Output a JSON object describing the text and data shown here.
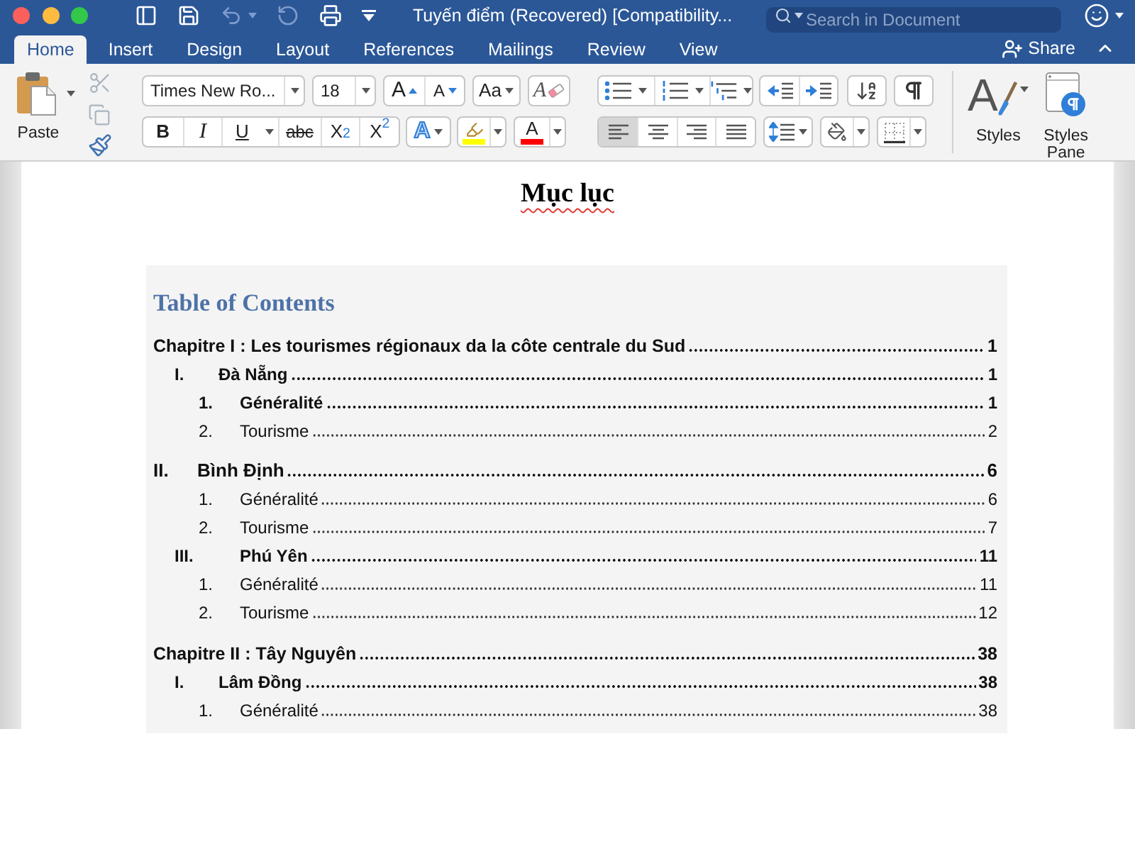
{
  "window": {
    "title": "Tuyến điểm (Recovered) [Compatibility...",
    "quick_access": [
      {
        "kind": "sidebar",
        "disabled": false
      },
      {
        "kind": "save",
        "disabled": false
      },
      {
        "kind": "undo",
        "disabled": true
      },
      {
        "kind": "redo",
        "disabled": true
      },
      {
        "kind": "print",
        "disabled": false
      },
      {
        "kind": "customize",
        "disabled": false
      }
    ],
    "search": {
      "placeholder": "Search in Document"
    }
  },
  "tabs": [
    {
      "label": "Home",
      "selected": true
    },
    {
      "label": "Insert",
      "selected": false
    },
    {
      "label": "Design",
      "selected": false
    },
    {
      "label": "Layout",
      "selected": false
    },
    {
      "label": "References",
      "selected": false
    },
    {
      "label": "Mailings",
      "selected": false
    },
    {
      "label": "Review",
      "selected": false
    },
    {
      "label": "View",
      "selected": false
    }
  ],
  "share": {
    "label": "Share"
  },
  "ribbon": {
    "clipboard": {
      "paste_label": "Paste",
      "tools": [
        {
          "kind": "cut",
          "disabled": true
        },
        {
          "kind": "copy",
          "disabled": true
        },
        {
          "kind": "painter",
          "disabled": false
        }
      ]
    },
    "font": {
      "name": "Times New Ro...",
      "size": "18",
      "size_buttons": [
        {
          "kind": "grow",
          "label": "A"
        },
        {
          "kind": "shrink",
          "label": "A"
        }
      ],
      "case_label": "Aa",
      "clear_label": "A",
      "format_buttons": [
        {
          "kind": "bold",
          "label": "B"
        },
        {
          "kind": "italic",
          "label": "I"
        },
        {
          "kind": "underline",
          "label": "U"
        },
        {
          "kind": "strike",
          "label": "abc"
        },
        {
          "kind": "sub",
          "label": "X$_{2}$"
        },
        {
          "kind": "sup",
          "label": "X$^{2}$"
        }
      ],
      "effects_label": "A",
      "highlight": {
        "color": "#ffff00"
      },
      "font_color": {
        "label": "A",
        "color": "#ff0000"
      }
    },
    "paragraph": {
      "lists": [
        {
          "kind": "bullets"
        },
        {
          "kind": "numbering"
        },
        {
          "kind": "multilevel"
        }
      ],
      "align": [
        {
          "kind": "left",
          "selected": true
        },
        {
          "kind": "center",
          "selected": false
        },
        {
          "kind": "right",
          "selected": false
        },
        {
          "kind": "justify",
          "selected": false
        }
      ]
    },
    "styles": {
      "icon_label": "A",
      "label": "Styles"
    },
    "styles_pane": {
      "label": "Styles Pane"
    }
  },
  "document": {
    "title": "Mục lục",
    "toc": {
      "heading": "Table of Contents",
      "chapters": [
        {
          "title": "Chapitre I : Les tourismes régionaux da la côte centrale du Sud",
          "page": "1",
          "children": [
            {
              "number": "I.",
              "title": "Đà Nẵng",
              "page": "1",
              "kind": "standard",
              "children": [
                {
                  "number": "1.",
                  "title": "Généralité",
                  "page": "1",
                  "bold": true
                },
                {
                  "number": "2.",
                  "title": "Tourisme",
                  "page": "2",
                  "bold": false
                }
              ]
            },
            {
              "number": "II.",
              "title": "Bình Định",
              "page": "6",
              "kind": "flush",
              "children": [
                {
                  "number": "1.",
                  "title": "Généralité",
                  "page": "6",
                  "bold": false
                },
                {
                  "number": "2.",
                  "title": "Tourisme",
                  "page": "7",
                  "bold": false
                }
              ]
            },
            {
              "number": "III.",
              "title": "Phú Yên",
              "page": "11",
              "kind": "wide",
              "children": [
                {
                  "number": "1.",
                  "title": "Généralité",
                  "page": "11",
                  "bold": false
                },
                {
                  "number": "2.",
                  "title": "Tourisme",
                  "page": "12",
                  "bold": false
                }
              ]
            }
          ]
        },
        {
          "title": "Chapitre II : Tây Nguyên",
          "page": "38",
          "children": [
            {
              "number": "I.",
              "title": "Lâm Đồng",
              "page": "38",
              "kind": "standard",
              "children": [
                {
                  "number": "1.",
                  "title": "Généralité",
                  "page": "38",
                  "bold": false
                }
              ]
            }
          ]
        }
      ]
    }
  }
}
